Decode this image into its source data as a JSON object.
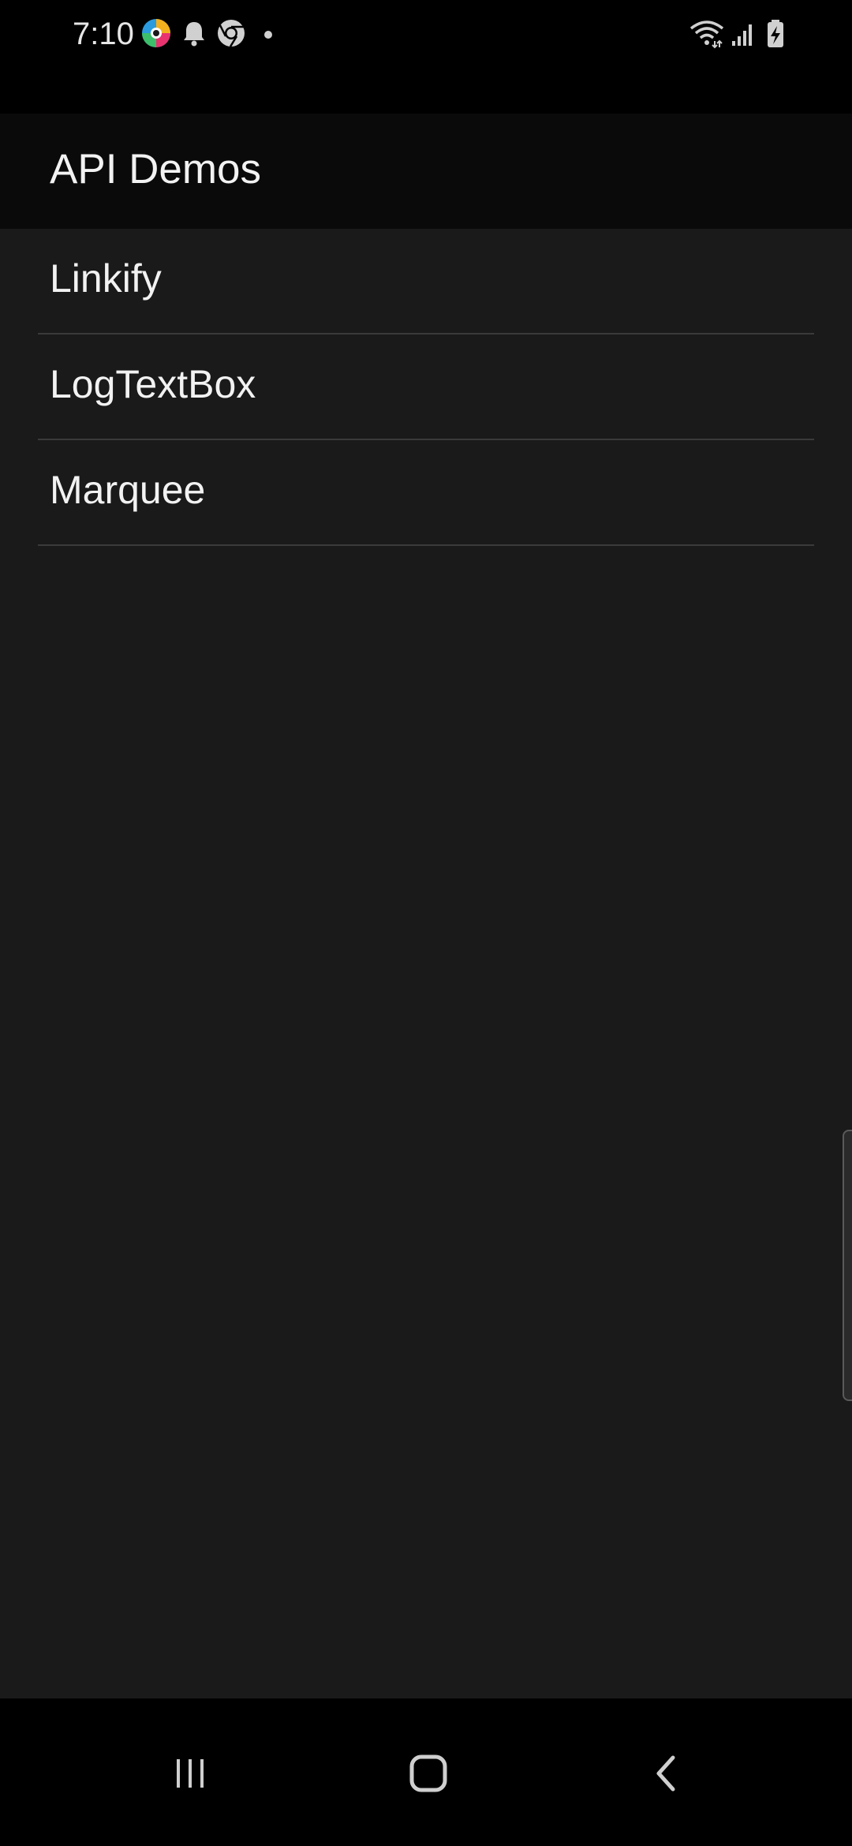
{
  "status_bar": {
    "time": "7:10",
    "left_icons": [
      "app-logo-icon",
      "notification-bell-icon",
      "chrome-icon",
      "dot-icon"
    ],
    "right_icons": [
      "wifi-icon",
      "signal-icon",
      "battery-charging-icon"
    ]
  },
  "app_bar": {
    "title": "API Demos"
  },
  "list": {
    "items": [
      {
        "label": "Linkify"
      },
      {
        "label": "LogTextBox"
      },
      {
        "label": "Marquee"
      }
    ]
  },
  "nav_bar": {
    "buttons": [
      "recent-apps-icon",
      "home-icon",
      "back-icon"
    ]
  },
  "colors": {
    "background": "#1a1a1a",
    "app_bar": "#0a0a0a",
    "text": "#f2f2f2",
    "divider": "#3a3a3a"
  }
}
